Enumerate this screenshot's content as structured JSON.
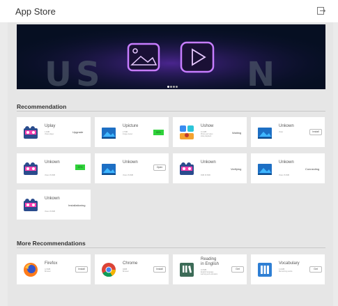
{
  "header": {
    "title": "App Store"
  },
  "sections": {
    "recommendation": "Recommendation",
    "more": "More Recommendations"
  },
  "recommendation_apps": [
    {
      "name": "Uplay",
      "meta1": "1.1MB",
      "meta2": "Video player",
      "action": "Upgrade"
    },
    {
      "name": "Upicture",
      "meta1": "2.7MB",
      "meta2": "Image viewer",
      "action": "50%"
    },
    {
      "name": "Ushow",
      "meta1": "10.1MB",
      "meta2": "Photo and video",
      "meta3": "slide playback",
      "action": "Waiting"
    },
    {
      "name": "Unkown",
      "meta1": "Video",
      "action": "Install"
    },
    {
      "name": "Unkown",
      "meta1": "Video  15.3MB",
      "action": "20%"
    },
    {
      "name": "Unkown",
      "meta1": "Video  15.3MB",
      "action": "Open"
    },
    {
      "name": "Unkown",
      "meta1": "4MB  15.3MB",
      "action": "Verifying"
    },
    {
      "name": "Unkown",
      "meta1": "Video  15.3MB",
      "action": "Connecting"
    },
    {
      "name": "Unkown",
      "meta1": "Video  15.3MB",
      "action": "Installationing"
    }
  ],
  "more_apps": [
    {
      "name": "Firefox",
      "meta1": "12.5MB",
      "meta2": "Browser",
      "action": "Install"
    },
    {
      "name": "Chrome",
      "meta1": "48MB",
      "meta2": "Browser",
      "action": "Install"
    },
    {
      "name": "Reading",
      "name2": "in English",
      "meta1": "10.5MB",
      "meta2": "English language",
      "meta3": "learning and education",
      "action": "Get"
    },
    {
      "name": "Vocabulary",
      "meta1": "14.0MB",
      "meta2": "Memorizing words",
      "action": "Get"
    }
  ],
  "colors": {
    "accent_green": "#2fd23a",
    "banner_bg": "#060f22",
    "neon_purple": "#b45dff"
  },
  "icons": [
    "exit-icon",
    "video-app-icon",
    "image-app-icon",
    "ushow-icon",
    "firefox-icon",
    "chrome-icon",
    "reading-icon",
    "vocabulary-icon"
  ],
  "carousel": {
    "slides": 4,
    "active": 1
  }
}
